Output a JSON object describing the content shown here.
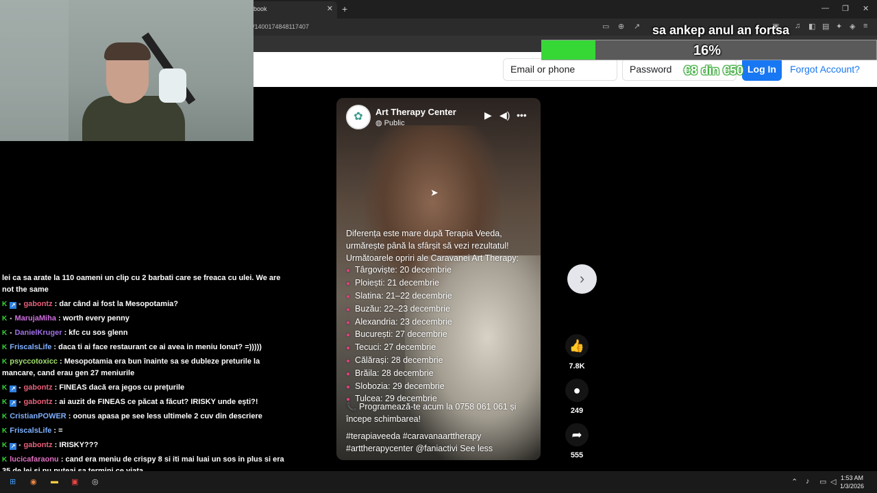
{
  "browser": {
    "tab_title": "book",
    "tab_close": "✕",
    "new_tab": "+",
    "url": "/1400174848117407",
    "window_controls": [
      "—",
      "❐",
      "✕"
    ]
  },
  "facebook_header": {
    "email_placeholder": "Email or phone",
    "password_placeholder": "Password",
    "login_label": "Log In",
    "forgot_label": "Forgot Account?"
  },
  "stream_overlay": {
    "title": "sa ankep anul an fortsa",
    "progress_percent": 16,
    "progress_label": "16%",
    "amount_label": "€8 din €50",
    "bar_color": "#36d836"
  },
  "post": {
    "page_name": "Art Therapy Center",
    "privacy": "Public",
    "privacy_icon": "globe-icon",
    "intro": "Diferența este mare după Terapia Veeda, urmărește până la sfârșit să vezi rezultatul! Următoarele opriri ale Caravanei Art Therapy:",
    "stops": [
      "Târgoviște: 20 decembrie",
      "Ploiești: 21 decembrie",
      "Slatina: 21–22 decembrie",
      "Buzău: 22–23 decembrie",
      "Alexandria: 23 decembrie",
      "București: 27 decembrie",
      "Tecuci: 27 decembrie",
      "Călărași: 28 decembrie",
      "Brăila: 28 decembrie",
      "Slobozia: 29 decembrie",
      "Tulcea: 29 decembrie"
    ],
    "cta": "Programează-te acum la 0758 061 061 și începe schimbarea!",
    "tags": "#terapiaveeda #caravanaarttherapy #arttherapycenter @faniactivi See less",
    "likes": "7.8K",
    "comments": "249",
    "shares": "555"
  },
  "chat": [
    {
      "user": "",
      "message": "lei ca sa arate la 110 oameni un clip cu 2 barbati care se freaca cu ulei. We are not the same",
      "color": "#ffffff",
      "badges": []
    },
    {
      "user": "gabontz",
      "message": " : dar când ai fost la Mesopotamia?",
      "color": "#e8607a",
      "badges": [
        "k",
        "blue",
        "dot"
      ]
    },
    {
      "user": "MarujaMiha",
      "message": " : worth every penny",
      "color": "#d070e0",
      "badges": [
        "k",
        "dot"
      ]
    },
    {
      "user": "DanielKruger",
      "message": " : kfc cu sos glenn",
      "color": "#a070e8",
      "badges": [
        "k",
        "dot"
      ]
    },
    {
      "user": "FriscalsLife",
      "message": " : daca ti ai face restaurant ce ai avea in meniu Ionut? =)))))",
      "color": "#7fb0ff",
      "badges": [
        "k"
      ]
    },
    {
      "user": "psyccotoxicc",
      "message": " : Mesopotamia era bun înainte sa se dubleze preturile la mancare, cand erau gen 27 meniurile",
      "color": "#a0e070",
      "badges": [
        "k"
      ]
    },
    {
      "user": "gabontz",
      "message": " : FINEAS dacă era jegos cu prețurile",
      "color": "#e8607a",
      "badges": [
        "k",
        "blue",
        "dot"
      ]
    },
    {
      "user": "gabontz",
      "message": " : ai auzit de FINEAS ce păcat a făcut? IRISKY unde ești?!",
      "color": "#e8607a",
      "badges": [
        "k",
        "blue",
        "dot"
      ]
    },
    {
      "user": "CristianPOWER",
      "message": " : oonus apasa pe see less ultimele 2 cuv din descriere",
      "color": "#7fb0ff",
      "badges": [
        "k"
      ]
    },
    {
      "user": "FriscalsLife",
      "message": " : =",
      "color": "#7fb0ff",
      "badges": [
        "k"
      ]
    },
    {
      "user": "gabontz",
      "message": " : IRISKY???",
      "color": "#e8607a",
      "badges": [
        "k",
        "blue",
        "dot"
      ]
    },
    {
      "user": "lucicafaraonu",
      "message": " : cand era meniu de crispy 8 si iti mai luai un sos in plus si era 35 de lei si nu puteai sa termini ce viata",
      "color": "#e070c0",
      "badges": [
        "k"
      ]
    },
    {
      "user": "FriscalsLife",
      "message": " : =))",
      "color": "#7fb0ff",
      "badges": [
        "k"
      ]
    }
  ],
  "taskbar": {
    "time": "1:53 AM",
    "date": "1/3/2026"
  }
}
